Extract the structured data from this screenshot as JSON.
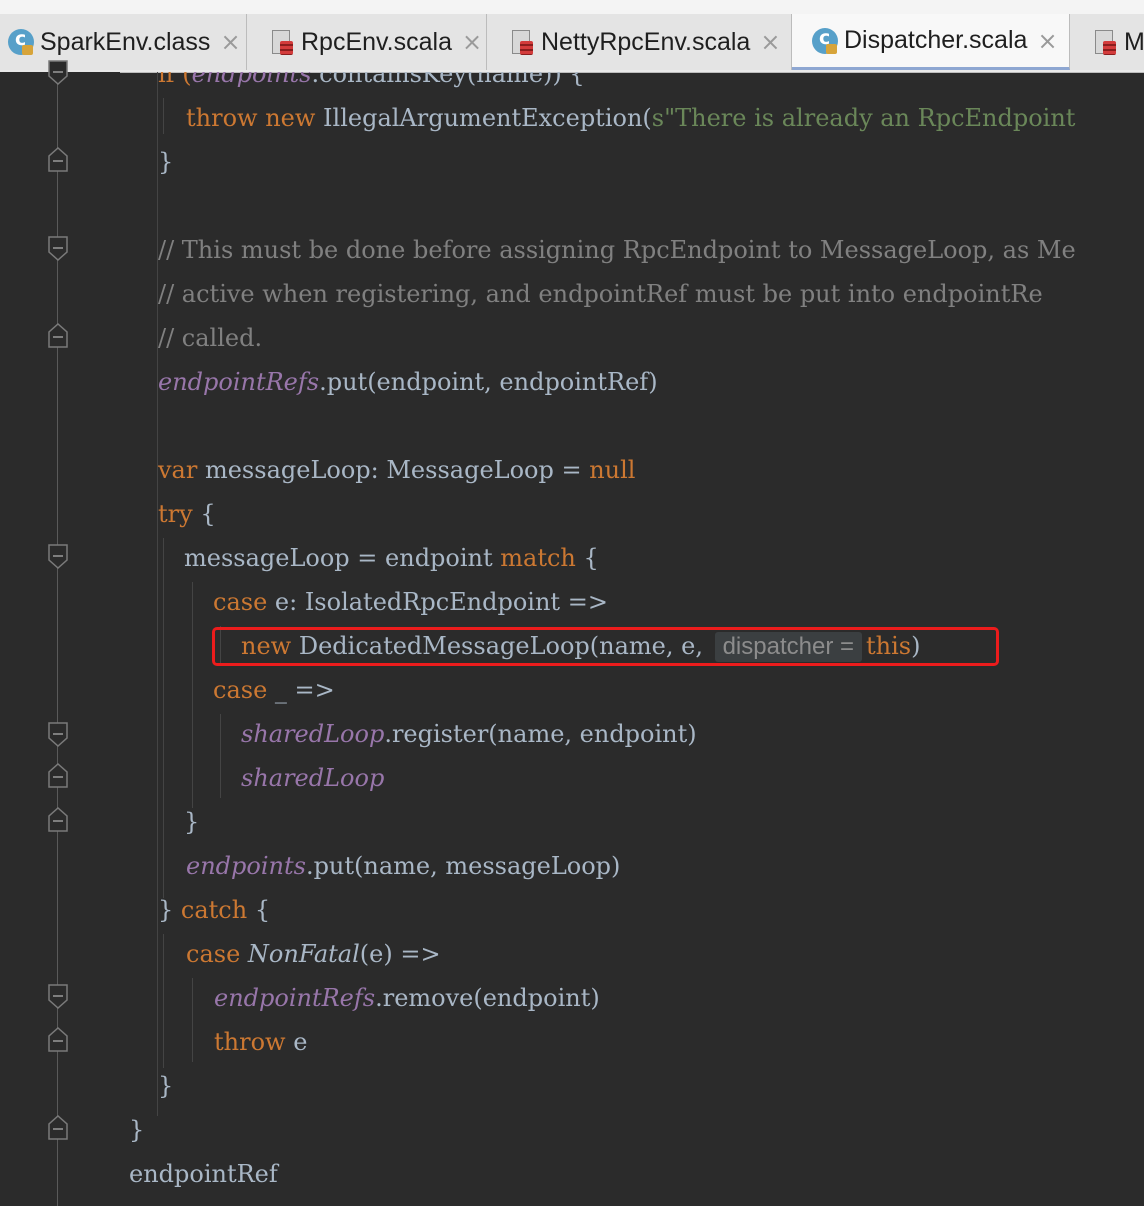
{
  "tabs": [
    {
      "label": "SparkEnv.class",
      "close": "×",
      "icon": "class-icon",
      "active": false
    },
    {
      "label": "RpcEnv.scala",
      "close": "×",
      "icon": "scala-file-icon",
      "active": false
    },
    {
      "label": "NettyRpcEnv.scala",
      "close": "×",
      "icon": "scala-file-icon",
      "active": false
    },
    {
      "label": "Dispatcher.scala",
      "close": "×",
      "icon": "scala-object-icon",
      "active": true
    },
    {
      "label": "M",
      "close": "",
      "icon": "scala-file-icon",
      "active": false
    }
  ],
  "code": {
    "l0": {
      "t1": "if (",
      "t2": "endpoints",
      "t3": ".containsKey(name)) {"
    },
    "l1": {
      "t1": "throw",
      "t2": " ",
      "t3": "new",
      "t4": " IllegalArgumentException(",
      "t5": "s\"There is already an RpcEndpoint"
    },
    "l2": {
      "t1": "}"
    },
    "l4": {
      "t1": "// This must be done before assigning RpcEndpoint to MessageLoop, as Me"
    },
    "l5": {
      "t1": "// active when registering, and endpointRef must be put into endpointRe"
    },
    "l6": {
      "t1": "// called."
    },
    "l7": {
      "t1": "endpointRefs",
      "t2": ".put(endpoint, endpointRef)"
    },
    "l9": {
      "t1": "var",
      "t2": " messageLoop: MessageLoop = ",
      "t3": "null"
    },
    "l10": {
      "t1": "try",
      "t2": " {"
    },
    "l11": {
      "t1": "messageLoop = endpoint ",
      "t2": "match",
      "t3": " {"
    },
    "l12": {
      "t1": "case",
      "t2": " e: IsolatedRpcEndpoint =>"
    },
    "l13": {
      "t1": "new",
      "t2": " DedicatedMessageLoop(name, e, ",
      "hint": "dispatcher =",
      "t3": "this",
      "t4": ")"
    },
    "l14": {
      "t1": "case",
      "t2": " _ =>"
    },
    "l15": {
      "t1": "sharedLoop",
      "t2": ".register(name, endpoint)"
    },
    "l16": {
      "t1": "sharedLoop"
    },
    "l17": {
      "t1": "}"
    },
    "l18": {
      "t1": "endpoints",
      "t2": ".put(name, messageLoop)"
    },
    "l19": {
      "t1": "} ",
      "t2": "catch",
      "t3": " {"
    },
    "l20": {
      "t1": "case",
      "t2": " ",
      "t3": "NonFatal",
      "t4": "(e) =>"
    },
    "l21": {
      "t1": "endpointRefs",
      "t2": ".remove(endpoint)"
    },
    "l22": {
      "t1": "throw",
      "t2": " e"
    },
    "l23": {
      "t1": "}"
    },
    "l24": {
      "t1": "}"
    },
    "l25": {
      "t1": "endpointRef"
    }
  },
  "colors": {
    "background": "#2b2b2b",
    "keyword": "#cc7832",
    "text": "#a9b7c6",
    "comment": "#808080",
    "field": "#9876aa",
    "string": "#6a8759",
    "highlight_box": "#ec1c1c"
  }
}
